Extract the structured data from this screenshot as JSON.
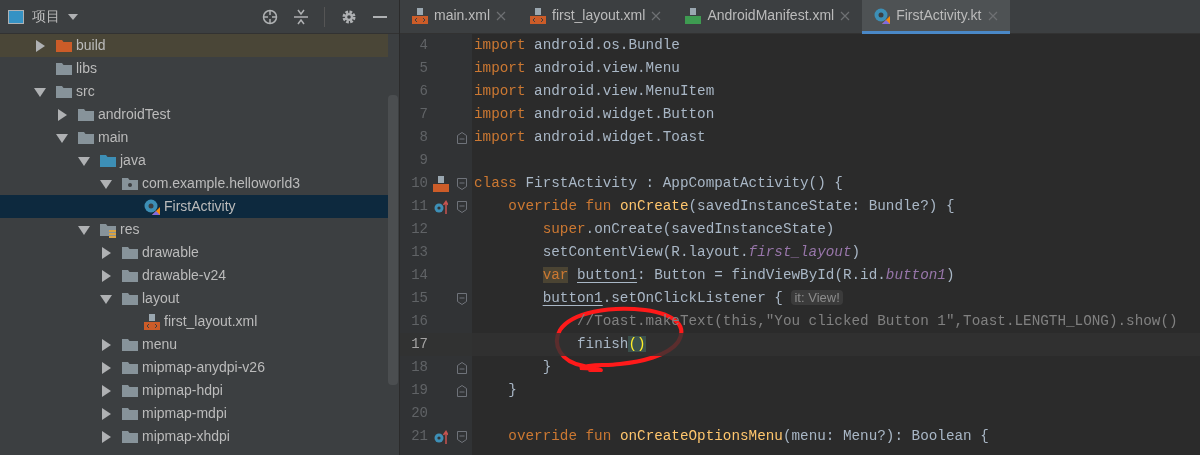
{
  "project_panel": {
    "title": "项目",
    "tree": [
      {
        "label": "build",
        "kind": "excluded-folder",
        "expanded": false,
        "selected": false
      },
      {
        "label": "libs",
        "kind": "folder",
        "selected": false
      },
      {
        "label": "src",
        "kind": "folder",
        "expanded": true,
        "selected": false,
        "children": [
          {
            "label": "androidTest",
            "kind": "folder",
            "expanded": false,
            "selected": false
          },
          {
            "label": "main",
            "kind": "folder",
            "expanded": true,
            "selected": false,
            "children": [
              {
                "label": "java",
                "kind": "source-folder",
                "expanded": true,
                "selected": false,
                "children": [
                  {
                    "label": "com.example.helloworld3",
                    "kind": "package",
                    "expanded": true,
                    "selected": false,
                    "children": [
                      {
                        "label": "FirstActivity",
                        "kind": "kotlin-class",
                        "selected": true
                      }
                    ]
                  }
                ]
              },
              {
                "label": "res",
                "kind": "resource-folder",
                "expanded": true,
                "selected": false,
                "children": [
                  {
                    "label": "drawable",
                    "kind": "folder",
                    "expanded": false,
                    "selected": false
                  },
                  {
                    "label": "drawable-v24",
                    "kind": "folder",
                    "expanded": false,
                    "selected": false
                  },
                  {
                    "label": "layout",
                    "kind": "folder",
                    "expanded": true,
                    "selected": false,
                    "children": [
                      {
                        "label": "first_layout.xml",
                        "kind": "xml-file",
                        "selected": false
                      }
                    ]
                  },
                  {
                    "label": "menu",
                    "kind": "folder",
                    "expanded": false,
                    "selected": false
                  },
                  {
                    "label": "mipmap-anydpi-v26",
                    "kind": "folder",
                    "expanded": false,
                    "selected": false
                  },
                  {
                    "label": "mipmap-hdpi",
                    "kind": "folder",
                    "expanded": false,
                    "selected": false
                  },
                  {
                    "label": "mipmap-mdpi",
                    "kind": "folder",
                    "expanded": false,
                    "selected": false
                  },
                  {
                    "label": "mipmap-xhdpi",
                    "kind": "folder",
                    "expanded": false,
                    "selected": false
                  }
                ]
              }
            ]
          }
        ]
      }
    ]
  },
  "tabs": [
    {
      "label": "main.xml",
      "kind": "xml",
      "selected": false
    },
    {
      "label": "first_layout.xml",
      "kind": "xml",
      "selected": false
    },
    {
      "label": "AndroidManifest.xml",
      "kind": "manifest",
      "selected": false
    },
    {
      "label": "FirstActivity.kt",
      "kind": "kotlin",
      "selected": true
    }
  ],
  "editor": {
    "lines": [
      {
        "number": "4",
        "tokens": [
          {
            "kind": "keyword",
            "text": "import"
          },
          {
            "kind": "plain",
            "text": " android.os.Bundle"
          }
        ]
      },
      {
        "number": "5",
        "tokens": [
          {
            "kind": "keyword",
            "text": "import"
          },
          {
            "kind": "plain",
            "text": " android.view.Menu"
          }
        ]
      },
      {
        "number": "6",
        "tokens": [
          {
            "kind": "keyword",
            "text": "import"
          },
          {
            "kind": "plain",
            "text": " android.view.MenuItem"
          }
        ]
      },
      {
        "number": "7",
        "tokens": [
          {
            "kind": "keyword",
            "text": "import"
          },
          {
            "kind": "plain",
            "text": " android.widget.Button"
          }
        ]
      },
      {
        "number": "8",
        "fold_end": true,
        "tokens": [
          {
            "kind": "keyword",
            "text": "import"
          },
          {
            "kind": "plain",
            "text": " android.widget.Toast"
          }
        ]
      },
      {
        "number": "9"
      },
      {
        "number": "10",
        "layout_marker": true,
        "fold_start": true,
        "tokens": [
          {
            "kind": "keyword",
            "text": "class"
          },
          {
            "kind": "plain",
            "text": " FirstActivity : AppCompatActivity() {"
          }
        ]
      },
      {
        "number": "11",
        "override_marker": true,
        "fold_start": true,
        "tokens": [
          {
            "kind": "keyword",
            "text": "    override fun "
          },
          {
            "kind": "declaration",
            "text": "onCreate"
          },
          {
            "kind": "plain",
            "text": "(savedInstanceState: Bundle?) {"
          }
        ]
      },
      {
        "number": "12",
        "tokens": [
          {
            "kind": "keyword",
            "text": "        super"
          },
          {
            "kind": "plain",
            "text": ".onCreate(savedInstanceState)"
          }
        ]
      },
      {
        "number": "13",
        "tokens": [
          {
            "kind": "plain",
            "text": "        setContentView(R.layout."
          },
          {
            "kind": "field",
            "text": "first_layout"
          },
          {
            "kind": "plain",
            "text": ")"
          }
        ]
      },
      {
        "number": "14",
        "tokens": [
          {
            "kind": "keyword-highlight",
            "text": "        var "
          },
          {
            "kind": "variable",
            "text": "button1"
          },
          {
            "kind": "plain",
            "text": ": Button = findViewById(R.id."
          },
          {
            "kind": "field",
            "text": "button1"
          },
          {
            "kind": "plain",
            "text": ")"
          }
        ]
      },
      {
        "number": "15",
        "fold_start": true,
        "tokens": [
          {
            "kind": "variable",
            "text": "        button1"
          },
          {
            "kind": "plain",
            "text": ".setOnClickListener { "
          },
          {
            "kind": "hint",
            "text": "it: View!"
          }
        ]
      },
      {
        "number": "16",
        "tokens": [
          {
            "kind": "comment",
            "text": "            //Toast.makeText(this,\"You clicked Button 1\",Toast.LENGTH_LONG).show()"
          }
        ]
      },
      {
        "number": "17",
        "current": true,
        "tokens": [
          {
            "kind": "plain",
            "text": "            finish"
          },
          {
            "kind": "brace-match",
            "text": "()"
          }
        ]
      },
      {
        "number": "18",
        "fold_end": true,
        "tokens": [
          {
            "kind": "plain",
            "text": "        }"
          }
        ]
      },
      {
        "number": "19",
        "fold_end": true,
        "tokens": [
          {
            "kind": "plain",
            "text": "    }"
          }
        ]
      },
      {
        "number": "20"
      },
      {
        "number": "21",
        "override_marker": true,
        "fold_start": true,
        "tokens": [
          {
            "kind": "keyword",
            "text": "    override fun "
          },
          {
            "kind": "declaration",
            "text": "onCreateOptionsMenu"
          },
          {
            "kind": "plain",
            "text": "(menu: Menu?): Boolean {"
          }
        ]
      }
    ]
  }
}
